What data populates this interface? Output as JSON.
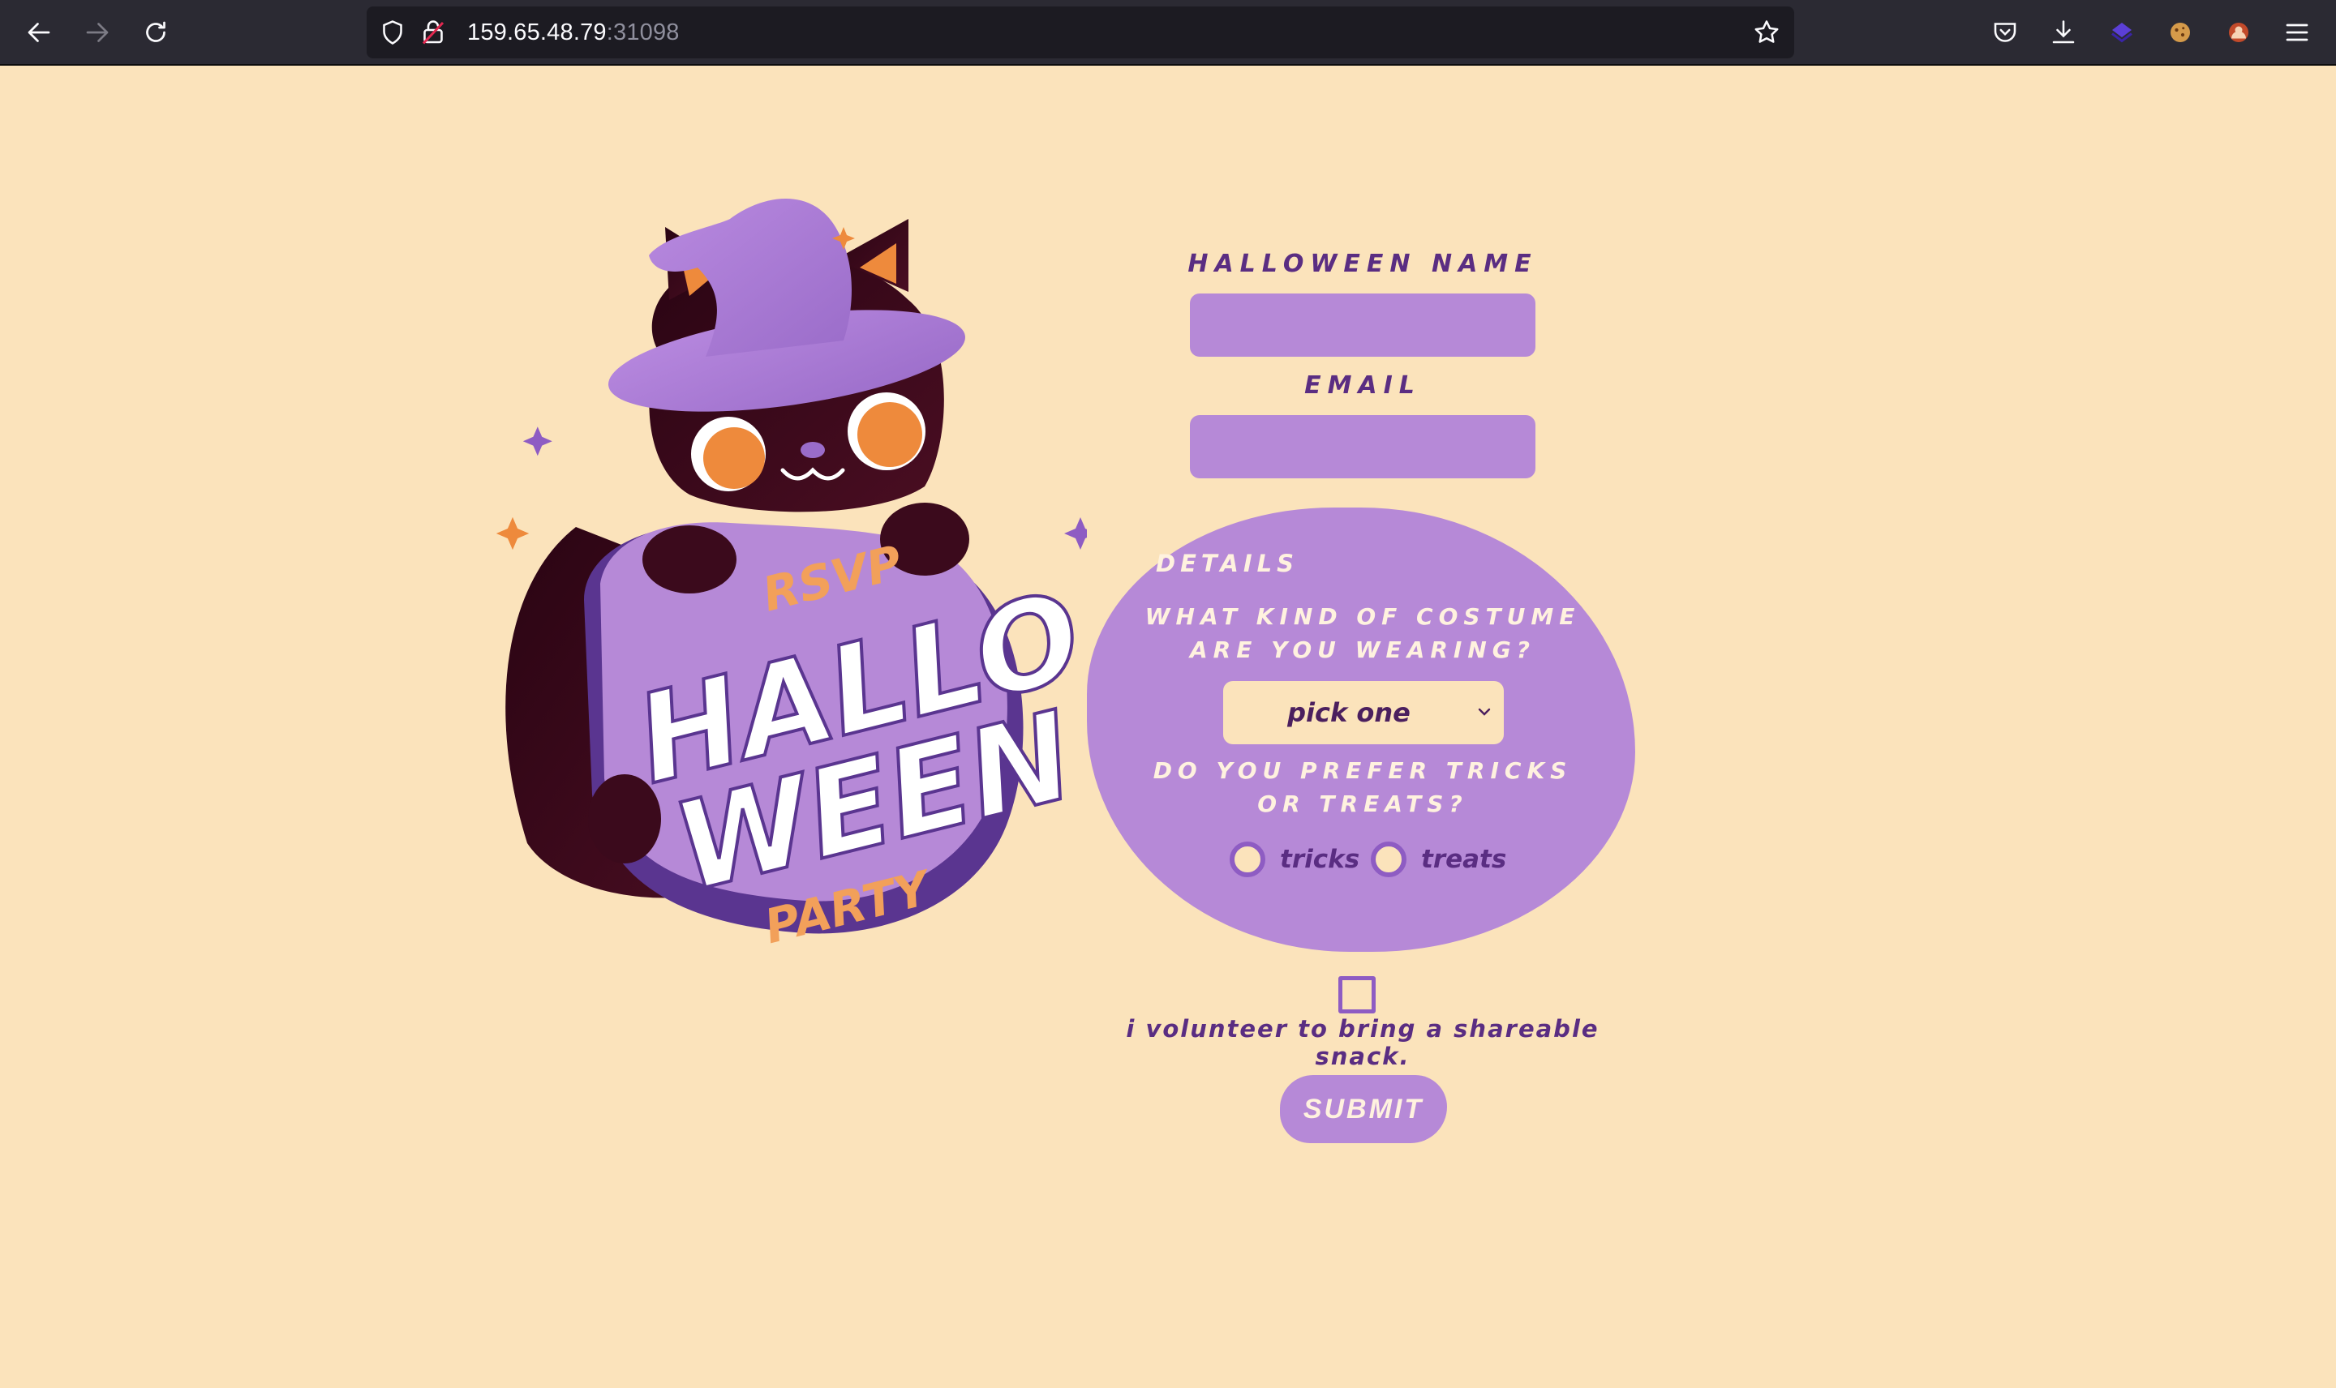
{
  "browser": {
    "url_host": "159.65.48.79",
    "url_port": ":31098",
    "icons": [
      "back-icon",
      "forward-icon",
      "reload-icon",
      "shield-icon",
      "insecure-lock-icon",
      "bookmark-star-icon",
      "pocket-icon",
      "download-icon",
      "extension-icon",
      "cookie-icon",
      "profile-icon",
      "menu-icon"
    ]
  },
  "artwork": {
    "rsvp": "RSVP",
    "hallo": "HALLO",
    "ween": "WEEN",
    "party": "PARTY"
  },
  "form": {
    "name_label": "HALLOWEEN NAME",
    "name_value": "",
    "email_label": "EMAIL",
    "email_value": "",
    "details_title": "DETAILS",
    "costume_question": "WHAT KIND OF COSTUME ARE YOU WEARING?",
    "costume_selected": "pick one",
    "tricks_question": "DO YOU PREFER TRICKS OR TREATS?",
    "radio_tricks": "tricks",
    "radio_treats": "treats",
    "snack_label": "i volunteer to bring a shareable snack.",
    "submit_label": "SUBMIT"
  },
  "colors": {
    "background": "#fbe3bb",
    "accent_purple": "#b689d7",
    "dark_purple": "#5a2d82",
    "orange": "#ee8a3c",
    "cat": "#3b0a1c"
  }
}
